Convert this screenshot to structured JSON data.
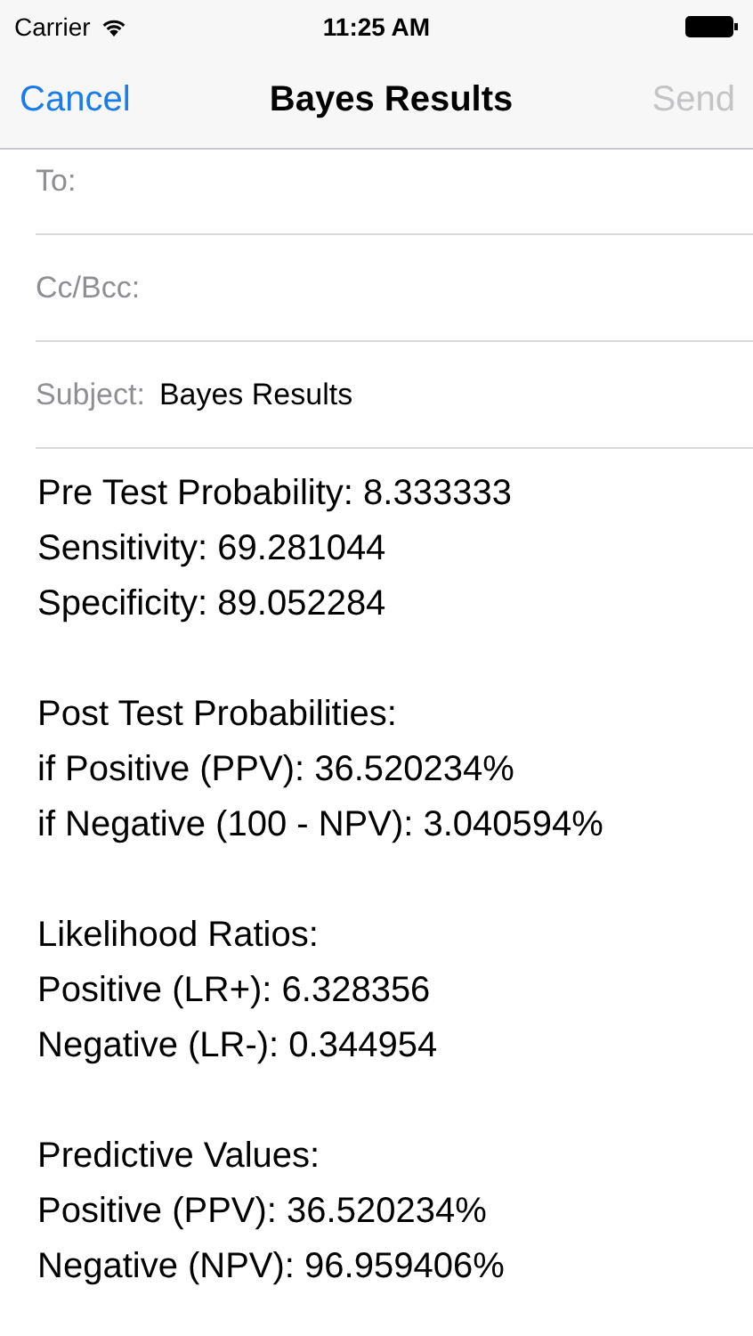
{
  "status_bar": {
    "carrier": "Carrier",
    "time": "11:25 AM"
  },
  "nav_bar": {
    "cancel": "Cancel",
    "title": "Bayes Results",
    "send": {
      "label": "Send",
      "disabled": true
    }
  },
  "fields": [
    {
      "label": "To:"
    },
    {
      "label": "Cc/Bcc:"
    },
    {
      "label": "Subject:",
      "value": "Bayes Results"
    }
  ],
  "body": [
    [
      "Pre Test Probability: 8.333333",
      "Sensitivity: 69.281044",
      "Specificity: 89.052284"
    ],
    [
      "Post Test Probabilities:",
      "if Positive (PPV): 36.520234%",
      "if Negative (100 - NPV): 3.040594%"
    ],
    [
      "Likelihood Ratios:",
      "Positive (LR+): 6.328356",
      "Negative (LR-): 0.344954"
    ],
    [
      "Predictive Values:",
      "Positive (PPV): 36.520234%",
      "Negative (NPV): 96.959406%"
    ]
  ]
}
